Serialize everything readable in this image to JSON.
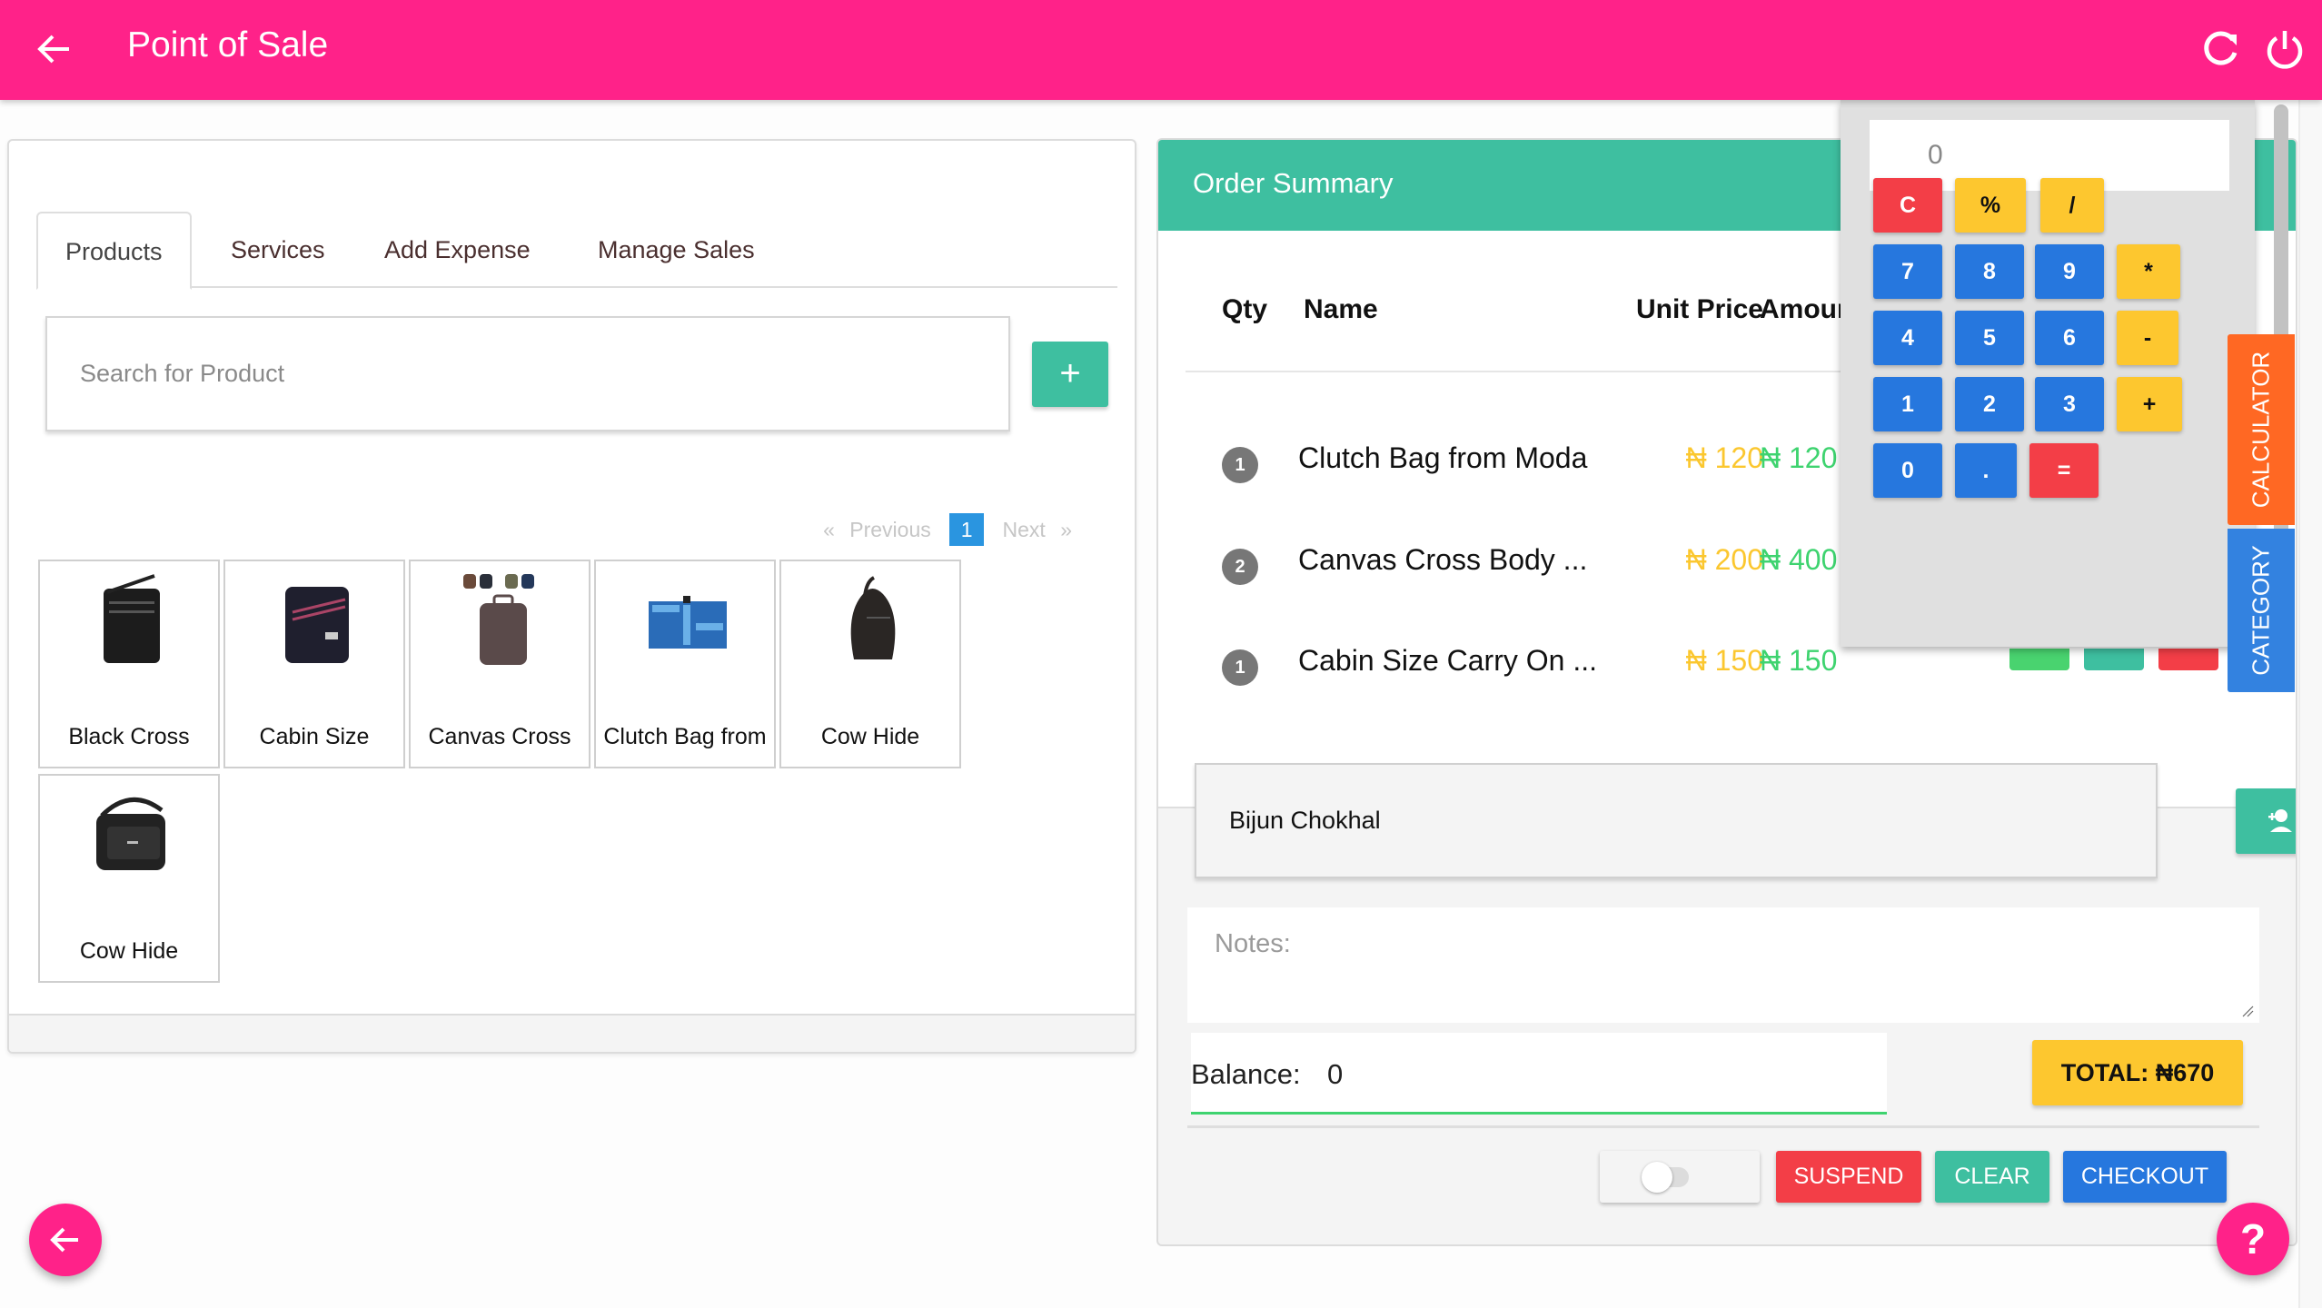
{
  "header": {
    "title": "Point of Sale",
    "back_icon": "arrow-left-icon",
    "refresh_icon": "refresh-icon",
    "power_icon": "power-icon",
    "color": "#ff2289"
  },
  "products_panel": {
    "tabs": [
      {
        "label": "Products",
        "active": true
      },
      {
        "label": "Services",
        "active": false
      },
      {
        "label": "Add Expense",
        "active": false
      },
      {
        "label": "Manage Sales",
        "active": false
      }
    ],
    "search_placeholder": "Search for Product",
    "search_value": "",
    "add_label": "+",
    "pagination": {
      "prev": "Previous",
      "prev_arrow": "«",
      "current": "1",
      "next": "Next",
      "next_arrow": "»"
    },
    "products": [
      {
        "name": "Black Cross",
        "image": "black-crossbody-bag"
      },
      {
        "name": "Cabin Size",
        "image": "cabin-size-bag"
      },
      {
        "name": "Canvas Cross",
        "image": "canvas-cross-bag"
      },
      {
        "name": "Clutch Bag from",
        "image": "clutch-bag"
      },
      {
        "name": "Cow Hide",
        "image": "cow-hide-backpack"
      },
      {
        "name": "Cow Hide",
        "image": "cow-hide-shoulder-bag"
      }
    ]
  },
  "order": {
    "title": "Order Summary",
    "columns": {
      "qty": "Qty",
      "name": "Name",
      "unit_price": "Unit Price",
      "amount": "Amount"
    },
    "items": [
      {
        "qty": "1",
        "name": "Clutch Bag from Moda",
        "unit_price": "₦ 120",
        "amount": "₦ 120"
      },
      {
        "qty": "2",
        "name": "Canvas Cross Body ...",
        "unit_price": "₦ 200",
        "amount": "₦ 400"
      },
      {
        "qty": "1",
        "name": "Cabin Size Carry On ...",
        "unit_price": "₦ 150",
        "amount": "₦ 150"
      }
    ],
    "customer": "Bijun Chokhal",
    "notes_placeholder": "Notes:",
    "notes_value": "",
    "balance_label": "Balance:",
    "balance_value": "0",
    "total": "TOTAL: ₦670",
    "toggle_on": false,
    "buttons": {
      "suspend": "SUSPEND",
      "clear": "CLEAR",
      "checkout": "CHECKOUT"
    }
  },
  "calculator": {
    "display": "0",
    "keys": [
      {
        "label": "C",
        "color": "red"
      },
      {
        "label": "%",
        "color": "yellow"
      },
      {
        "label": "/",
        "color": "yellow"
      },
      {
        "label": "7",
        "color": "blue"
      },
      {
        "label": "8",
        "color": "blue"
      },
      {
        "label": "9",
        "color": "blue"
      },
      {
        "label": "*",
        "color": "yellow"
      },
      {
        "label": "4",
        "color": "blue"
      },
      {
        "label": "5",
        "color": "blue"
      },
      {
        "label": "6",
        "color": "blue"
      },
      {
        "label": "-",
        "color": "yellow"
      },
      {
        "label": "1",
        "color": "blue"
      },
      {
        "label": "2",
        "color": "blue"
      },
      {
        "label": "3",
        "color": "blue"
      },
      {
        "label": "+",
        "color": "yellow"
      },
      {
        "label": "0",
        "color": "blue"
      },
      {
        "label": ".",
        "color": "blue"
      },
      {
        "label": "=",
        "color": "red"
      }
    ]
  },
  "side_tabs": {
    "calculator": "CALCULATOR",
    "category": "CATEGORY"
  },
  "fabs": {
    "back_icon": "arrow-left-icon",
    "help": "?"
  },
  "colors": {
    "primary": "#ff2289",
    "teal": "#3ebfa0",
    "blue": "#2677de",
    "red": "#f33e47",
    "yellow": "#fdc72f",
    "green": "#3ed36f",
    "orange": "#ff6823"
  }
}
